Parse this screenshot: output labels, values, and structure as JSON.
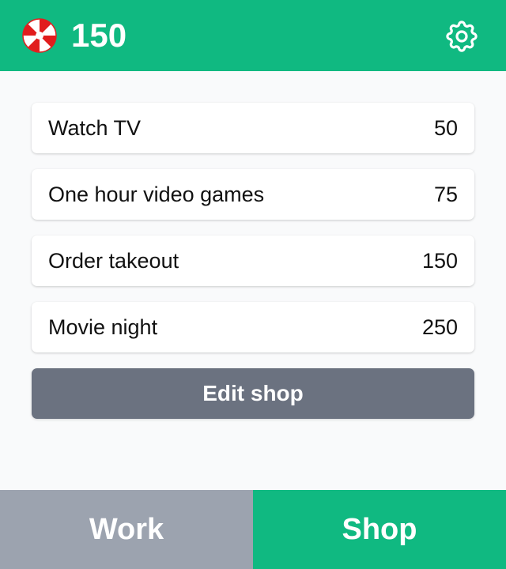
{
  "header": {
    "balance": "150",
    "candy_icon": "peppermint-candy-icon",
    "settings_icon": "gear-icon",
    "colors": {
      "bar": "#10b981",
      "text": "#ffffff"
    }
  },
  "shop": {
    "items": [
      {
        "label": "Watch TV",
        "price": "50"
      },
      {
        "label": "One hour video games",
        "price": "75"
      },
      {
        "label": "Order takeout",
        "price": "150"
      },
      {
        "label": "Movie night",
        "price": "250"
      }
    ],
    "edit_label": "Edit shop"
  },
  "nav": {
    "work_label": "Work",
    "shop_label": "Shop",
    "active": "Shop",
    "colors": {
      "active": "#10b981",
      "inactive": "#9ca3af"
    }
  }
}
